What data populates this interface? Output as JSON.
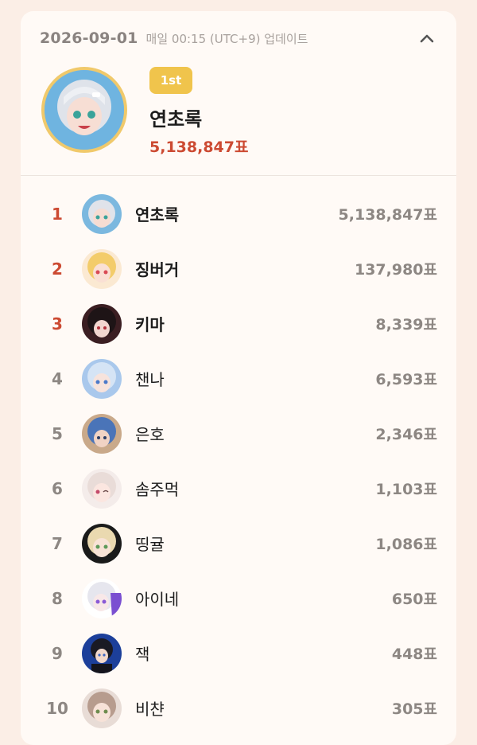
{
  "header": {
    "date": "2026-09-01",
    "update_note": "매일 00:15 (UTC+9) 업데이트"
  },
  "winner": {
    "badge": "1st",
    "name": "연초록",
    "votes": "5,138,847표"
  },
  "rankings": [
    {
      "rank": "1",
      "name": "연초록",
      "votes": "5,138,847표"
    },
    {
      "rank": "2",
      "name": "징버거",
      "votes": "137,980표"
    },
    {
      "rank": "3",
      "name": "키마",
      "votes": "8,339표"
    },
    {
      "rank": "4",
      "name": "챈나",
      "votes": "6,593표"
    },
    {
      "rank": "5",
      "name": "은호",
      "votes": "2,346표"
    },
    {
      "rank": "6",
      "name": "솜주먹",
      "votes": "1,103표"
    },
    {
      "rank": "7",
      "name": "띵귤",
      "votes": "1,086표"
    },
    {
      "rank": "8",
      "name": "아이네",
      "votes": "650표"
    },
    {
      "rank": "9",
      "name": "잭",
      "votes": "448표"
    },
    {
      "rank": "10",
      "name": "비챤",
      "votes": "305표"
    }
  ],
  "colors": {
    "background": "#fbeee6",
    "card": "#fffaf6",
    "accent_red": "#cc4a32",
    "badge_gold": "#f0c44c",
    "muted": "#8d8783"
  },
  "icons": {
    "collapse": "chevron-up-icon"
  }
}
